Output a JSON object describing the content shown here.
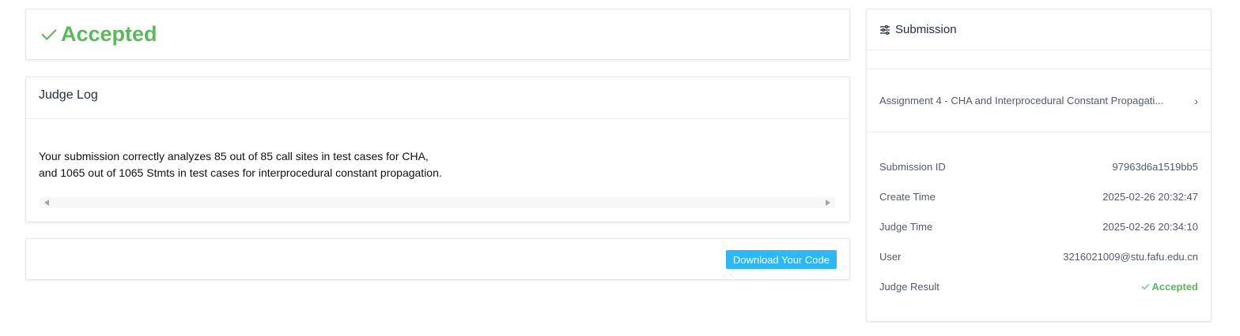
{
  "status": {
    "label": "Accepted",
    "color": "#5cb85c",
    "icon": "check-icon"
  },
  "judge_log": {
    "title": "Judge Log",
    "lines": [
      "Your submission correctly analyzes 85 out of 85 call sites in test cases for CHA,",
      "and 1065 out of 1065 Stmts in test cases for interprocedural constant propagation."
    ]
  },
  "download": {
    "label": "Download Your Code",
    "color": "#2db7f5"
  },
  "submission": {
    "title": "Submission",
    "icon": "sliders-icon",
    "assignment_label": "Assignment 4 - CHA and Interprocedural Constant Propagati...",
    "fields": [
      {
        "label": "Submission ID",
        "value": "97963d6a1519bb5"
      },
      {
        "label": "Create Time",
        "value": "2025-02-26 20:32:47"
      },
      {
        "label": "Judge Time",
        "value": "2025-02-26 20:34:10"
      },
      {
        "label": "User",
        "value": "3216021009@stu.fafu.edu.cn"
      }
    ],
    "judge_result": {
      "label": "Judge Result",
      "value": "Accepted"
    }
  }
}
